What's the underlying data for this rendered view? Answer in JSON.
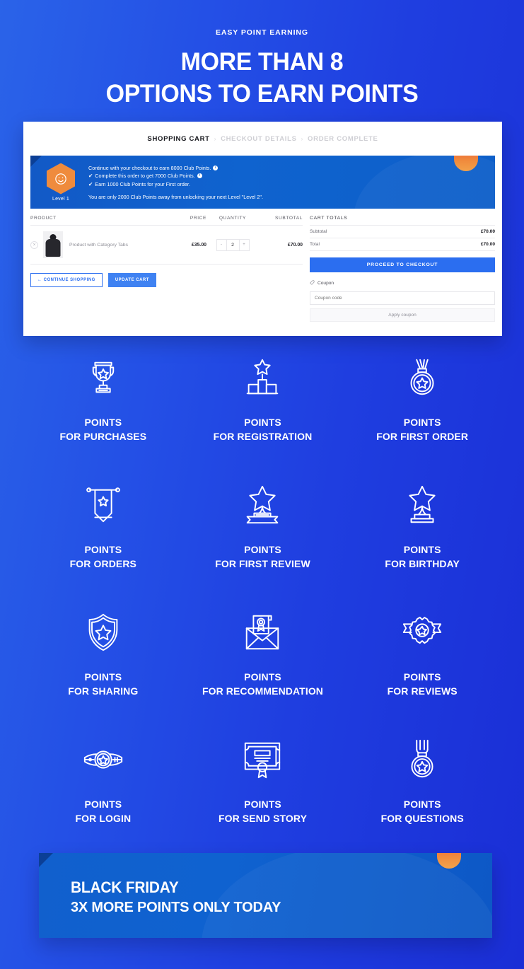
{
  "theme": {
    "bg_from": "#2a63e8",
    "bg_to": "#1a2ed6",
    "accent_blue": "#2b6ef0",
    "accent_orange": "#ef8b3d",
    "banner_blue": "#0f63cf"
  },
  "hero": {
    "eyebrow": "EASY POINT EARNING",
    "title_line1": "MORE THAN 8",
    "title_line2": "OPTIONS TO EARN POINTS"
  },
  "screenshot": {
    "breadcrumb": [
      {
        "label": "SHOPPING CART",
        "active": true
      },
      {
        "label": "CHECKOUT DETAILS",
        "active": false
      },
      {
        "label": "ORDER COMPLETE",
        "active": false
      }
    ],
    "breadcrumb_separator": "›",
    "loyalty": {
      "level_label": "Level 1",
      "badge_icon": "smiley-face-icon",
      "line1": "Continue with your checkout to earn 8000 Club Points.",
      "line2": "Complete this order to get 7000 Club Points.",
      "line3": "Earn 1000 Club Points for your First order.",
      "footer": "You are only 2000 Club Points away from unlocking your next Level \"Level 2\".",
      "tick": "✔",
      "info_glyph": "i"
    },
    "table": {
      "headers": [
        "PRODUCT",
        "PRICE",
        "QUANTITY",
        "SUBTOTAL"
      ],
      "rows": [
        {
          "remove": "×",
          "name": "Product with Category Tabs",
          "price": "£35.00",
          "qty_minus": "-",
          "qty": "2",
          "qty_plus": "+",
          "subtotal": "£70.00"
        }
      ]
    },
    "actions": {
      "continue_shopping": "← CONTINUE SHOPPING",
      "update_cart": "UPDATE CART"
    },
    "totals": {
      "title": "CART TOTALS",
      "rows": [
        {
          "label": "Subtotal",
          "value": "£70.00"
        },
        {
          "label": "Total",
          "value": "£70.00"
        }
      ],
      "checkout_button": "PROCEED TO CHECKOUT",
      "coupon_heading": "Coupon",
      "coupon_icon": "tag-icon",
      "coupon_placeholder": "Coupon code",
      "apply_coupon": "Apply coupon"
    }
  },
  "features": [
    {
      "icon": "trophy-star-icon",
      "line1": "POINTS",
      "line2": "FOR PURCHASES"
    },
    {
      "icon": "podium-star-icon",
      "line1": "POINTS",
      "line2": "FOR REGISTRATION"
    },
    {
      "icon": "medal-star-icon",
      "line1": "POINTS",
      "line2": "FOR FIRST ORDER"
    },
    {
      "icon": "banner-star-icon",
      "line1": "POINTS",
      "line2": "FOR ORDERS"
    },
    {
      "icon": "star-trophy-ribbon-icon",
      "line1": "POINTS",
      "line2": "FOR FIRST REVIEW"
    },
    {
      "icon": "star-pedestal-icon",
      "line1": "POINTS",
      "line2": "FOR BIRTHDAY"
    },
    {
      "icon": "shield-star-icon",
      "line1": "POINTS",
      "line2": "FOR SHARING"
    },
    {
      "icon": "envelope-certificate-icon",
      "line1": "POINTS",
      "line2": "FOR RECOMMENDATION"
    },
    {
      "icon": "rosette-star-icon",
      "line1": "POINTS",
      "line2": "FOR REVIEWS"
    },
    {
      "icon": "champion-belt-icon",
      "line1": "POINTS",
      "line2": "FOR LOGIN"
    },
    {
      "icon": "certificate-seal-icon",
      "line1": "POINTS",
      "line2": "FOR SEND STORY"
    },
    {
      "icon": "hanging-medal-icon",
      "line1": "POINTS",
      "line2": "FOR QUESTIONS"
    }
  ],
  "promo": {
    "title": "BLACK FRIDAY",
    "subtitle": "3X MORE POINTS ONLY TODAY"
  }
}
